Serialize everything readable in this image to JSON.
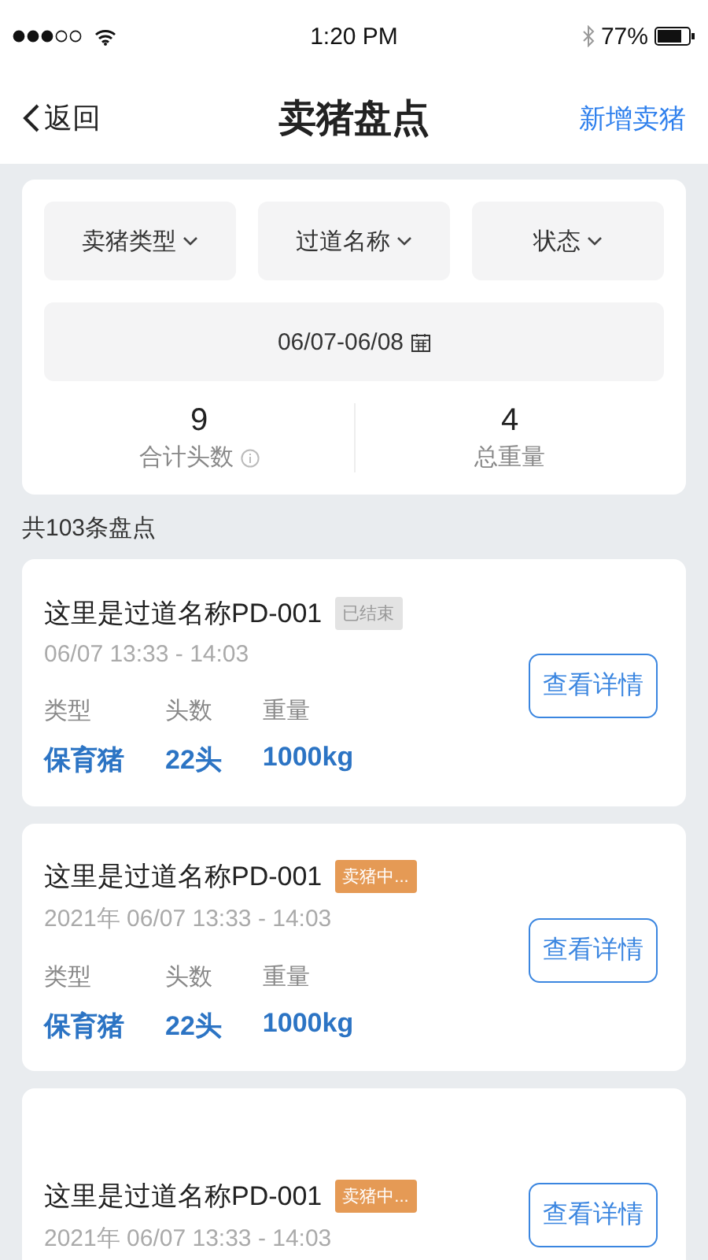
{
  "status_bar": {
    "time": "1:20 PM",
    "battery": "77%"
  },
  "nav": {
    "back": "返回",
    "title": "卖猪盘点",
    "action": "新增卖猪"
  },
  "filters": [
    "卖猪类型",
    "过道名称",
    "状态"
  ],
  "date_range": "06/07-06/08",
  "stats": [
    {
      "value": "9",
      "label": "合计头数",
      "info": true
    },
    {
      "value": "4",
      "label": "总重量",
      "info": false
    }
  ],
  "count": "共103条盘点",
  "records": [
    {
      "name": "这里是过道名称PD-001",
      "status": {
        "kind": "ended",
        "text": "已结束"
      },
      "time": "06/07 13:33 - 14:03",
      "fields": [
        {
          "label": "类型",
          "value": "保育猪"
        },
        {
          "label": "头数",
          "value": "22头"
        },
        {
          "label": "重量",
          "value": "1000kg"
        }
      ],
      "button": "查看详情"
    },
    {
      "name": "这里是过道名称PD-001",
      "status": {
        "kind": "selling",
        "text": "卖猪中..."
      },
      "time": "2021年 06/07 13:33 - 14:03",
      "fields": [
        {
          "label": "类型",
          "value": "保育猪"
        },
        {
          "label": "头数",
          "value": "22头"
        },
        {
          "label": "重量",
          "value": "1000kg"
        }
      ],
      "button": "查看详情"
    },
    {
      "name": "这里是过道名称PD-001",
      "status": {
        "kind": "selling",
        "text": "卖猪中..."
      },
      "time": "2021年 06/07 13:33 - 14:03",
      "button": "查看详情"
    }
  ]
}
